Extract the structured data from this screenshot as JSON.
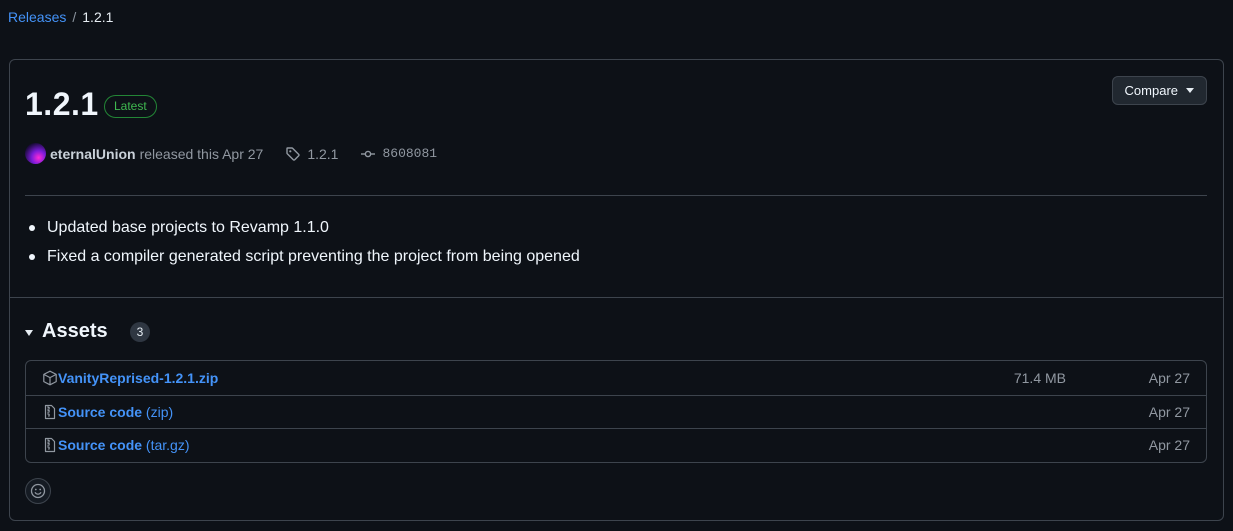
{
  "breadcrumb": {
    "releases_label": "Releases",
    "separator": "/",
    "current": "1.2.1"
  },
  "release": {
    "title": "1.2.1",
    "latest_badge": "Latest",
    "compare_label": "Compare",
    "author": "eternalUnion",
    "released_text": "released this Apr 27",
    "tag": "1.2.1",
    "commit": "8608081",
    "notes": [
      "Updated base projects to Revamp 1.1.0",
      "Fixed a compiler generated script preventing the project from being opened"
    ]
  },
  "assets": {
    "title": "Assets",
    "count": "3",
    "items": [
      {
        "icon": "package-icon",
        "name": "VanityReprised-1.2.1.zip",
        "sub": "",
        "size": "71.4 MB",
        "date": "Apr 27"
      },
      {
        "icon": "file-zip-icon",
        "name": "Source code",
        "sub": "(zip)",
        "size": "",
        "date": "Apr 27"
      },
      {
        "icon": "file-zip-icon",
        "name": "Source code",
        "sub": "(tar.gz)",
        "size": "",
        "date": "Apr 27"
      }
    ]
  },
  "colors": {
    "background": "#0d1117",
    "border": "#3d444d",
    "link": "#4493f8",
    "latest_green": "#3fb950",
    "muted": "#9198a1"
  }
}
